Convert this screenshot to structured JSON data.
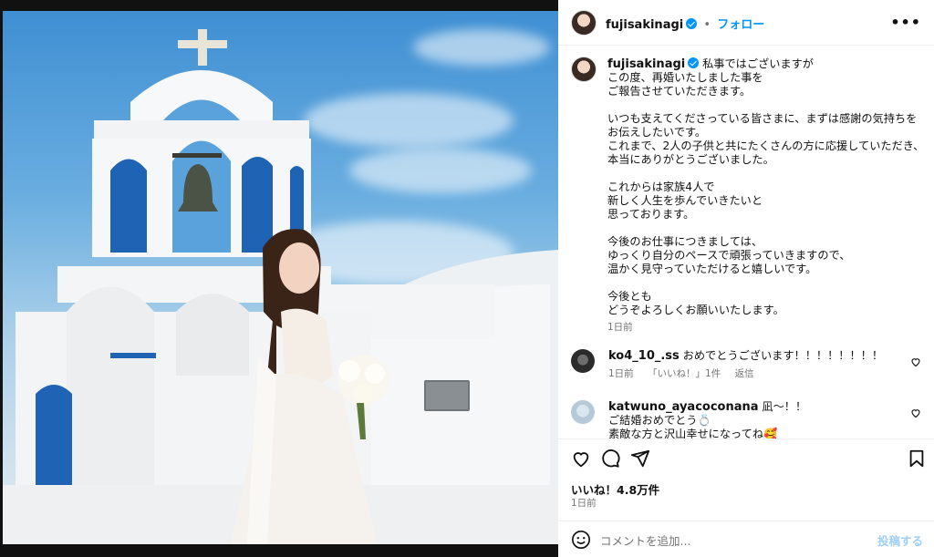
{
  "header": {
    "username": "fujisakinagi",
    "separator": "•",
    "follow_label": "フォロー",
    "more_label": "•••"
  },
  "caption": {
    "username": "fujisakinagi",
    "lines": [
      "私事ではございますが",
      "この度、再婚いたしました事を",
      "ご報告させていただきます。",
      "",
      "いつも支えてくださっている皆さまに、まずは感謝の気持ちを",
      "お伝えしたいです。",
      "これまで、2人の子供と共にたくさんの方に応援していただき、",
      "本当にありがとうございました。",
      "",
      "これからは家族4人で",
      "新しく人生を歩んでいきたいと",
      "思っております。",
      "",
      "今後のお仕事につきましては、",
      "ゆっくり自分のペースで頑張っていきますので、",
      "温かく見守っていただけると嬉しいです。",
      "",
      "今後とも",
      "どうぞよろしくお願いいたします。"
    ],
    "time": "1日前"
  },
  "comments": [
    {
      "username": "ko4_10_.ss",
      "lines": [
        "おめでとうございます！！！！！！！！"
      ],
      "time": "1日前",
      "likes": "「いいね！」1件",
      "reply": "返信"
    },
    {
      "username": "katwuno_ayacoconana",
      "lines": [
        "凪〜！！",
        "ご結婚おめでとう💍",
        "素敵な方と沢山幸せになってね🥰"
      ]
    }
  ],
  "post": {
    "likes": "いいね！4.8万件",
    "time": "1日前"
  },
  "comment_box": {
    "placeholder": "コメントを追加...",
    "post_label": "投稿する"
  },
  "colors": {
    "accent": "#0095f6",
    "muted": "#737373"
  }
}
